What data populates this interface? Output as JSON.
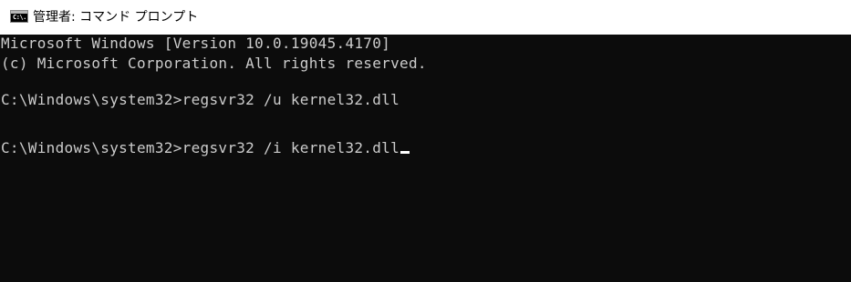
{
  "window": {
    "title": "管理者: コマンド プロンプト",
    "icon": "cmd-icon",
    "icon_text": "C:\\."
  },
  "console": {
    "lines": [
      "Microsoft Windows [Version 10.0.19045.4170]",
      "(c) Microsoft Corporation. All rights reserved.",
      "",
      "C:\\Windows\\system32>regsvr32 /u kernel32.dll",
      "",
      "C:\\Windows\\system32>regsvr32 /i kernel32.dll"
    ]
  },
  "colors": {
    "background": "#0c0c0c",
    "text": "#cccccc",
    "titlebar": "#ffffff",
    "cursor": "#ffffff"
  }
}
